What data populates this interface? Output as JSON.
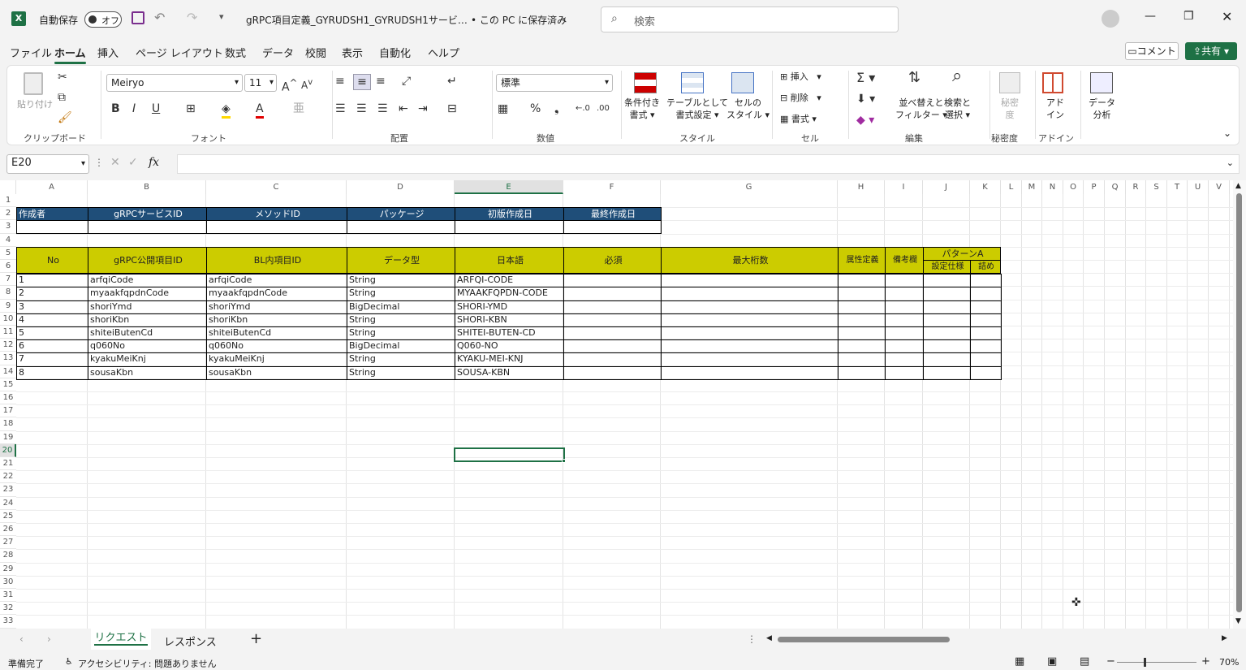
{
  "titlebar": {
    "autosave_label": "自動保存",
    "autosave_state": "オフ",
    "file_name": "gRPC項目定義_GYRUDSH1_GYRUDSH1サービ…",
    "save_status": "• この PC に保存済み",
    "search_placeholder": "検索"
  },
  "tabs": [
    "ファイル",
    "ホーム",
    "挿入",
    "ページ レイアウト",
    "数式",
    "データ",
    "校閲",
    "表示",
    "自動化",
    "ヘルプ"
  ],
  "top_right": {
    "comment": "コメント",
    "share": "共有"
  },
  "ribbon": {
    "clipboard": {
      "label": "クリップボード",
      "paste": "貼り付け"
    },
    "font": {
      "label": "フォント",
      "name": "Meiryo",
      "size": "11"
    },
    "align": {
      "label": "配置"
    },
    "number": {
      "label": "数値",
      "format": "標準"
    },
    "styles": {
      "label": "スタイル",
      "cond1": "条件付き",
      "cond2": "書式",
      "table1": "テーブルとして",
      "table2": "書式設定",
      "cell1": "セルの",
      "cell2": "スタイル"
    },
    "cells": {
      "label": "セル",
      "insert": "挿入",
      "delete": "削除",
      "format": "書式"
    },
    "edit": {
      "label": "編集",
      "sort1": "並べ替えと",
      "sort2": "フィルター",
      "find1": "検索と",
      "find2": "選択"
    },
    "sensitivity": {
      "label": "秘密度",
      "l1": "秘密",
      "l2": "度"
    },
    "addin": {
      "label": "アドイン",
      "l1": "アド",
      "l2": "イン"
    },
    "analyze": {
      "l1": "データ",
      "l2": "分析"
    }
  },
  "formula_bar": {
    "name_box": "E20",
    "fx": "fx",
    "value": ""
  },
  "columns": [
    "A",
    "B",
    "C",
    "D",
    "E",
    "F",
    "G",
    "H",
    "I",
    "J",
    "K",
    "L",
    "M",
    "N",
    "O",
    "P",
    "Q",
    "R",
    "S",
    "T",
    "U",
    "V"
  ],
  "rows": [
    "1",
    "2",
    "3",
    "4",
    "5",
    "6",
    "7",
    "8",
    "9",
    "10",
    "11",
    "12",
    "13",
    "14",
    "15",
    "16",
    "17",
    "18",
    "19",
    "20",
    "21",
    "22",
    "23",
    "24",
    "25",
    "26",
    "27",
    "28",
    "29",
    "30",
    "31",
    "32",
    "33"
  ],
  "header_row": [
    "作成者",
    "gRPCサービスID",
    "メソッドID",
    "パッケージ",
    "初版作成日",
    "最終作成日"
  ],
  "table_header": {
    "no": "No",
    "b": "gRPC公開項目ID",
    "c": "BL内項目ID",
    "d": "データ型",
    "e": "日本語",
    "f": "必須",
    "g": "最大桁数",
    "h": "属性定義",
    "i": "備考欄",
    "jk": "パターンA",
    "j": "設定仕様",
    "k": "詰め"
  },
  "table_rows": [
    [
      "1",
      "arfqiCode",
      "arfqiCode",
      "String",
      "ARFQI-CODE"
    ],
    [
      "2",
      "myaakfqpdnCode",
      "myaakfqpdnCode",
      "String",
      "MYAAKFQPDN-CODE"
    ],
    [
      "3",
      "shoriYmd",
      "shoriYmd",
      "BigDecimal",
      "SHORI-YMD"
    ],
    [
      "4",
      "shoriKbn",
      "shoriKbn",
      "String",
      "SHORI-KBN"
    ],
    [
      "5",
      "shiteiButenCd",
      "shiteiButenCd",
      "String",
      "SHITEI-BUTEN-CD"
    ],
    [
      "6",
      "q060No",
      "q060No",
      "BigDecimal",
      "Q060-NO"
    ],
    [
      "7",
      "kyakuMeiKnj",
      "kyakuMeiKnj",
      "String",
      "KYAKU-MEI-KNJ"
    ],
    [
      "8",
      "sousaKbn",
      "sousaKbn",
      "String",
      "SOUSA-KBN"
    ]
  ],
  "sheets": [
    "リクエスト",
    "レスポンス"
  ],
  "status": {
    "ready": "準備完了",
    "accessibility": "アクセシビリティ: 問題ありません",
    "zoom": "70%"
  },
  "colors": {
    "accent": "#1e7145",
    "blue_header": "#1f4e79",
    "yellow_header": "#cccc00"
  }
}
